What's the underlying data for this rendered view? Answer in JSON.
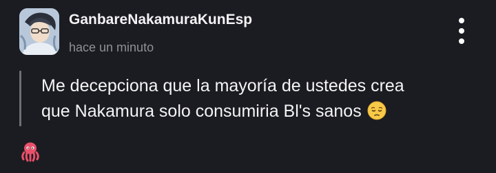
{
  "post": {
    "author": "GanbareNakamuraKunEsp",
    "timestamp": "hace un minuto",
    "message_lines": [
      "Me decepciona que la mayoría de ustedes crea",
      "que Nakamura solo consumiria Bl's sanos"
    ],
    "inline_emoji": "pensive-face",
    "reaction_emoji": "octopus",
    "menu_icon": "vertical-ellipsis-icon",
    "colors": {
      "background": "#1b1c21",
      "text": "#f4f4f6",
      "muted": "#8f9096",
      "quote_bar": "#6e6f76"
    }
  }
}
